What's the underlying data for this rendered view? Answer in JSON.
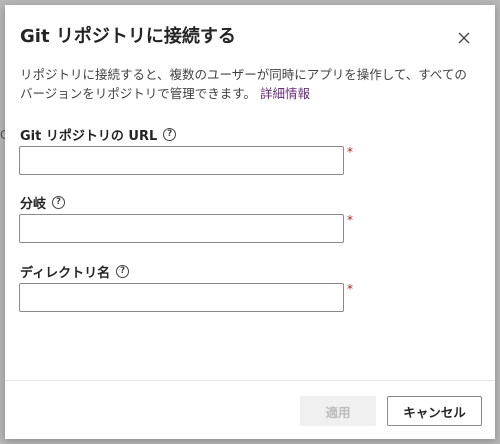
{
  "backdrop": {
    "glyph": "C"
  },
  "dialog": {
    "title": "Git リポジトリに接続する",
    "close_icon": "close-icon",
    "description": "リポジトリに接続すると、複数のユーザーが同時にアプリを操作して、すべてのバージョンをリポジトリで管理できます。",
    "learn_more": "詳細情報",
    "fields": [
      {
        "label": "Git リポジトリの URL",
        "value": "",
        "required_mark": "*",
        "help_icon": "help-icon"
      },
      {
        "label": "分岐",
        "value": "",
        "required_mark": "*",
        "help_icon": "help-icon"
      },
      {
        "label": "ディレクトリ名",
        "value": "",
        "required_mark": "*",
        "help_icon": "help-icon"
      }
    ],
    "help_glyph": "?",
    "buttons": {
      "apply": "適用",
      "cancel": "キャンセル"
    }
  }
}
